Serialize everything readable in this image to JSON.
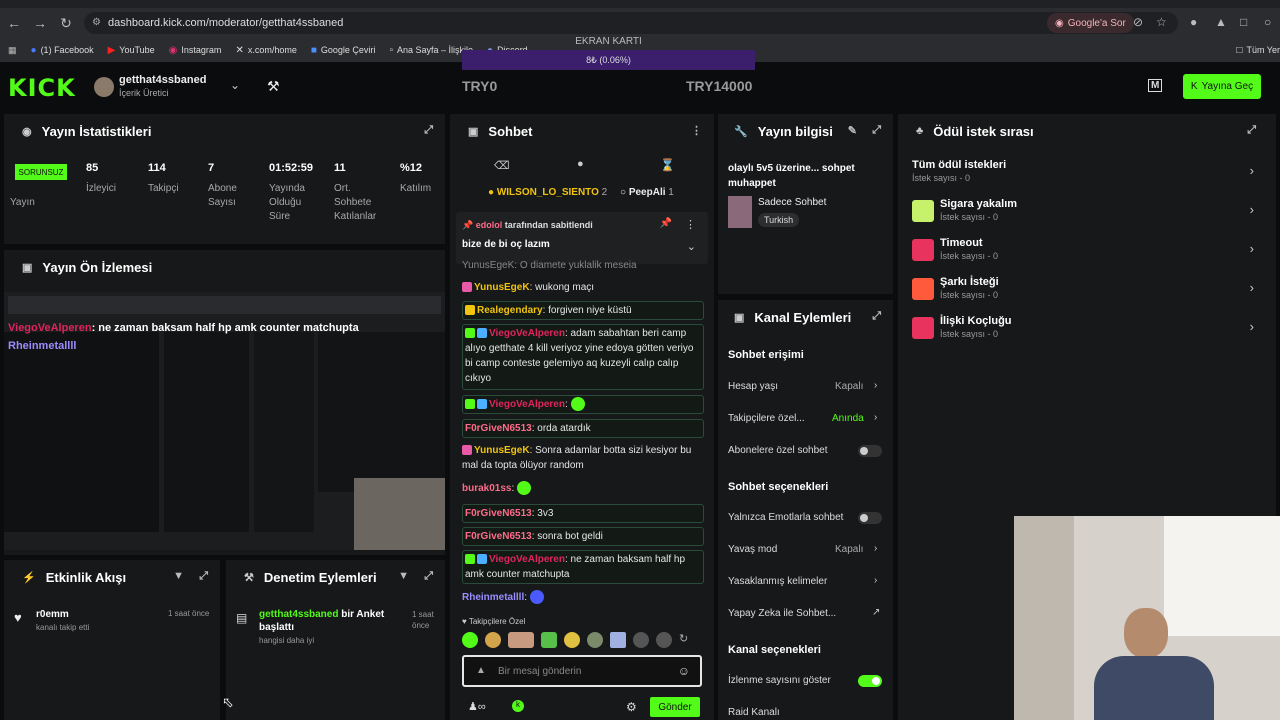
{
  "browser": {
    "url": "dashboard.kick.com/moderator/getthat4ssbaned",
    "ask_google": "Google'a Sor",
    "bookmarks": [
      "(1) Facebook",
      "YouTube",
      "Instagram",
      "x.com/home",
      "Google Çeviri",
      "Ana Sayfa – İlişkile",
      "Discord"
    ],
    "all_bookmarks": "Tüm Yer"
  },
  "ekran_karti": {
    "title": "EKRAN KARTI",
    "progress_text": "8₺ (0.06%)",
    "progress": 0.0006
  },
  "header": {
    "logo": "KICK",
    "username": "getthat4ssbaned",
    "role": "İçerik Üretici",
    "try_start": "TRY0",
    "try_goal": "TRY14000",
    "go_live": "Yayına Geç"
  },
  "stats": {
    "title": "Yayın İstatistikleri",
    "status_badge": "SORUNSUZ",
    "status_label": "Yayın",
    "items": [
      {
        "value": "85",
        "label": "İzleyici"
      },
      {
        "value": "114",
        "label": "Takipçi"
      },
      {
        "value": "7",
        "label": "Abone Sayısı"
      },
      {
        "value": "01:52:59",
        "label": "Yayında Olduğu Süre"
      },
      {
        "value": "11",
        "label": "Ort. Sohbete Katılanlar"
      },
      {
        "value": "%12",
        "label": "Katılım"
      }
    ]
  },
  "preview": {
    "title": "Yayın Ön İzlemesi",
    "overlay_user": "ViegoVeAlperen",
    "overlay_text": ": ne zaman baksam half hp amk counter matchupta",
    "overlay_user2": "Rheinmetallll"
  },
  "activity": {
    "title": "Etkinlik Akışı",
    "user": "r0emm",
    "text": "kanalı takip etti",
    "time": "1 saat önce"
  },
  "moderation": {
    "title": "Denetim Eylemleri",
    "user": "getthat4ssbaned",
    "action": "bir Anket başlattı",
    "detail": "hangisi daha iyi",
    "time": "1 saat önce"
  },
  "chat": {
    "title": "Sohbet",
    "top_users": [
      {
        "name": "WILSON_LO_SIENTO",
        "count": "2"
      },
      {
        "name": "PeepAli",
        "count": "1"
      }
    ],
    "pinned": {
      "user": "edolol",
      "suffix": "tarafından sabitlendi",
      "text": "bize de bi oç lazım"
    },
    "partial_line": "YunusEgeK: O diamete yuklalik meseia",
    "messages": [
      {
        "user": "YunusEgeK",
        "color": "#f1c40f",
        "text": ": wukong maçı"
      },
      {
        "user": "Realegendary",
        "color": "#f1c40f",
        "text": ": forgiven niye küstü"
      },
      {
        "user": "ViegoVeAlperen",
        "color": "#e0245e",
        "text": ": adam sabahtan beri camp alıyo getthate 4 kill veriyoz yine edoya götten veriyo bi camp conteste gelemiyo aq kuzeyli calıp calıp cıkıyo"
      },
      {
        "user": "ViegoVeAlperen",
        "color": "#e0245e",
        "text": ":"
      },
      {
        "user": "F0rGiveN6513",
        "color": "#ff6b8a",
        "text": ": orda atardık"
      },
      {
        "user": "YunusEgeK",
        "color": "#f1c40f",
        "text": ": Sonra adamlar botta sizi kesiyor bu mal da topta ölüyor random"
      },
      {
        "user": "burak01ss",
        "color": "#ff6b8a",
        "text": ":"
      },
      {
        "user": "F0rGiveN6513",
        "color": "#ff6b8a",
        "text": ": 3v3"
      },
      {
        "user": "F0rGiveN6513",
        "color": "#ff6b8a",
        "text": ": sonra bot geldi"
      },
      {
        "user": "ViegoVeAlperen",
        "color": "#e0245e",
        "text": ": ne zaman baksam half hp amk counter matchupta"
      },
      {
        "user": "Rheinmetallll",
        "color": "#9b8cff",
        "text": ":"
      }
    ],
    "followers_only": "Takipçilere Özel",
    "input_placeholder": "Bir mesaj gönderin",
    "send": "Gönder"
  },
  "stream_info": {
    "title": "Yayın bilgisi",
    "stream_title": "olaylı 5v5 üzerine... sohpet muhappet",
    "category": "Sadece Sohbet",
    "tag": "Turkish"
  },
  "channel_actions": {
    "title": "Kanal Eylemleri",
    "chat_access": "Sohbet erişimi",
    "account_age": {
      "label": "Hesap yaşı",
      "value": "Kapalı"
    },
    "followers_only": {
      "label": "Takipçilere özel...",
      "value": "Anında"
    },
    "subs_only": {
      "label": "Abonelere özel sohbet",
      "on": false
    },
    "chat_options": "Sohbet seçenekleri",
    "emotes_only": {
      "label": "Yalnızca Emotlarla sohbet",
      "on": false
    },
    "slow_mode": {
      "label": "Yavaş mod",
      "value": "Kapalı"
    },
    "banned_words": "Yasaklanmış kelimeler",
    "ai_chat": "Yapay Zeka ile Sohbet...",
    "channel_options": "Kanal seçenekleri",
    "show_viewers": {
      "label": "İzlenme sayısını göster",
      "on": true
    },
    "raid": "Raid Kanalı"
  },
  "rewards": {
    "title": "Ödül istek sırası",
    "items": [
      {
        "title": "Tüm ödül istekleri",
        "sub": "İstek sayısı - 0",
        "color": ""
      },
      {
        "title": "Sigara yakalım",
        "sub": "İstek sayısı - 0",
        "color": "#c6f26b"
      },
      {
        "title": "Timeout",
        "sub": "İstek sayısı - 0",
        "color": "#e8335e"
      },
      {
        "title": "Şarkı İsteği",
        "sub": "İstek sayısı - 0",
        "color": "#ff5a3c"
      },
      {
        "title": "İlişki Koçluğu",
        "sub": "İstek sayısı - 0",
        "color": "#e8335e"
      }
    ]
  }
}
